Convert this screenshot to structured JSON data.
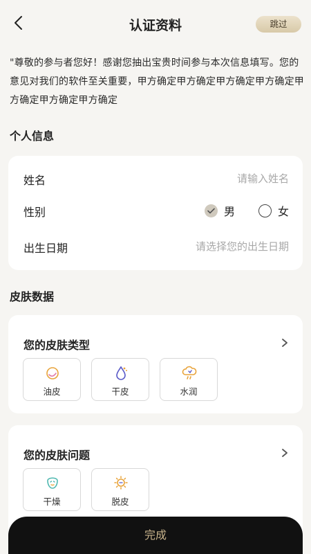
{
  "header": {
    "title": "认证资料",
    "skip_label": "跳过",
    "back_icon": "chevron-left-icon"
  },
  "notice": "\"尊敬的参与者您好！感谢您抽出宝贵时间参与本次信息填写。您的意见对我们的软件至关重要，甲方确定甲方确定甲方确定甲方确定甲方确定甲方确定甲方确定",
  "personal": {
    "section_title": "个人信息",
    "name_label": "姓名",
    "name_placeholder": "请输入姓名",
    "gender_label": "性别",
    "gender_options": [
      {
        "label": "男",
        "selected": true
      },
      {
        "label": "女",
        "selected": false
      }
    ],
    "birth_label": "出生日期",
    "birth_placeholder": "请选择您的出生日期"
  },
  "skin": {
    "section_title": "皮肤数据",
    "type_card": {
      "title": "您的皮肤类型",
      "options": [
        {
          "label": "油皮",
          "icon": "oil-drop-icon"
        },
        {
          "label": "干皮",
          "icon": "dry-drop-icon"
        },
        {
          "label": "水润",
          "icon": "moist-cloud-icon"
        }
      ]
    },
    "problem_card": {
      "title": "您的皮肤问题",
      "options": [
        {
          "label": "干燥",
          "icon": "dry-face-icon"
        },
        {
          "label": "脱皮",
          "icon": "sun-peel-icon"
        }
      ]
    }
  },
  "footer": {
    "done_label": "完成"
  },
  "colors": {
    "accent_gold": "#c9b48c",
    "skip_bg": "#ddd0b3",
    "button_dark": "#111111",
    "placeholder": "#a8a8a8",
    "page_bg": "#f6f5f2"
  }
}
